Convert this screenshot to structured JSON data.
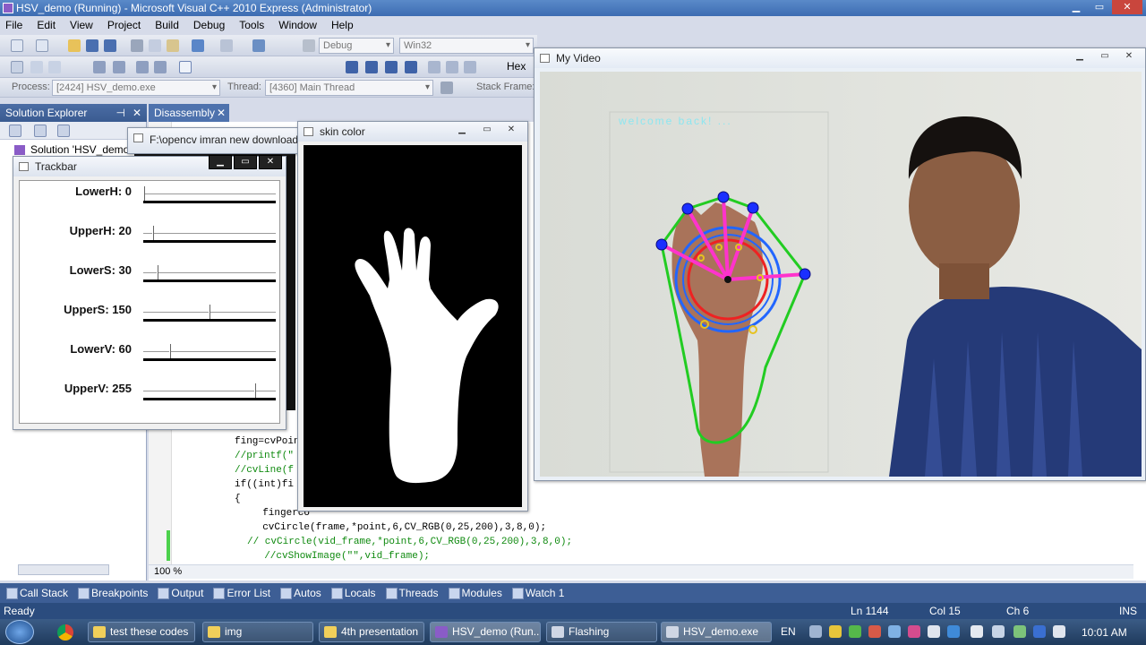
{
  "window": {
    "title": "HSV_demo (Running) - Microsoft Visual C++ 2010 Express (Administrator)"
  },
  "menu": [
    "File",
    "Edit",
    "View",
    "Project",
    "Build",
    "Debug",
    "Tools",
    "Window",
    "Help"
  ],
  "toolbar": {
    "config": "Debug",
    "platform": "Win32",
    "hex_label": "Hex",
    "process_label": "Process:",
    "process_value": "[2424] HSV_demo.exe",
    "thread_label": "Thread:",
    "thread_value": "[4360] Main Thread",
    "stackframe_label": "Stack Frame:"
  },
  "panels": {
    "solution_explorer": "Solution Explorer",
    "solution_item": "Solution 'HSV_demo'",
    "disassembly_tab": "Disassembly",
    "file_path": "F:\\opencv imran new download\\",
    "zoom": "100 %"
  },
  "code_lines": [
    "fing=cvPoint",
    "//printf(\"",
    "//cvLine(f",
    "if((int)fi",
    "{",
    "  fingerco",
    "  cvCircle(frame,*point,6,CV_RGB(0,25,200),3,8,0);",
    "// cvCircle(vid_frame,*point,6,CV_RGB(0,25,200),3,8,0);",
    "  //cvShowImage(\"\",vid_frame);"
  ],
  "trackbar": {
    "title": "Trackbar",
    "rows": [
      {
        "label": "LowerH: 0",
        "value": 0,
        "max": 255
      },
      {
        "label": "UpperH: 20",
        "value": 20,
        "max": 255
      },
      {
        "label": "LowerS: 30",
        "value": 30,
        "max": 255
      },
      {
        "label": "UpperS: 150",
        "value": 150,
        "max": 255
      },
      {
        "label": "LowerV: 60",
        "value": 60,
        "max": 255
      },
      {
        "label": "UpperV: 255",
        "value": 255,
        "max": 255
      }
    ]
  },
  "skin_window": {
    "title": "skin color"
  },
  "video_window": {
    "title": "My Video",
    "overlay_text": "welcome back! ..."
  },
  "bottom_tabs": [
    "Call Stack",
    "Breakpoints",
    "Output",
    "Error List",
    "Autos",
    "Locals",
    "Threads",
    "Modules",
    "Watch 1"
  ],
  "status": {
    "left": "Ready",
    "ln": "Ln 1144",
    "col": "Col 15",
    "ch": "Ch 6",
    "mode": "INS"
  },
  "taskbar": {
    "items": [
      "test these codes",
      "img",
      "4th presentation",
      "HSV_demo (Run...",
      "Flashing",
      "HSV_demo.exe"
    ],
    "lang": "EN",
    "clock": "10:01 AM"
  },
  "colors": {
    "title_bar": "#3d6cb2",
    "status_bar": "#2b4c7e",
    "taskbar": "#1f3a5c",
    "hull": "#22cc22",
    "fingers": "#ff33cc",
    "circle_red": "#ee2222",
    "circle_blue": "#2266ff"
  }
}
